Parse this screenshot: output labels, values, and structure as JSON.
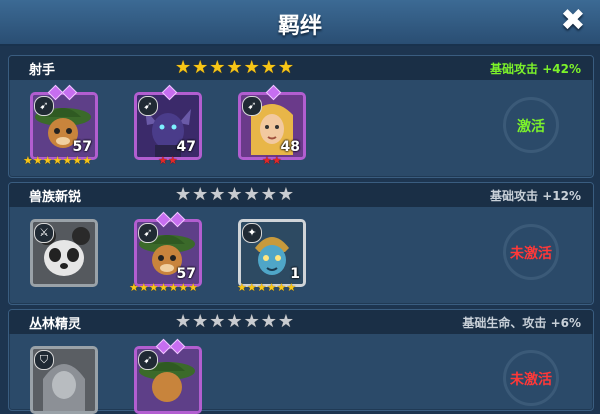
{
  "header": {
    "title": "羁绊",
    "close_icon": "close-icon"
  },
  "sections": [
    {
      "title": "射手",
      "stars": {
        "filled": 7,
        "total": 7
      },
      "bonus": "基础攻击 +42%",
      "bonus_color": "#7cf22a",
      "status": "激活",
      "heroes": [
        {
          "level": "57",
          "class_icon": "bow-icon",
          "stars": 7,
          "star_color": "gold",
          "gems": 2
        },
        {
          "level": "47",
          "class_icon": "bow-icon",
          "stars": 2,
          "star_color": "red",
          "gems": 1
        },
        {
          "level": "48",
          "class_icon": "bow-icon",
          "stars": 2,
          "star_color": "red",
          "gems": 1
        }
      ]
    },
    {
      "title": "兽族新锐",
      "stars": {
        "filled": 0,
        "total": 7
      },
      "bonus": "基础攻击 +12%",
      "bonus_color": "#c8d0d8",
      "status": "未激活",
      "heroes": [
        {
          "level": "",
          "class_icon": "sword-icon",
          "stars": 0,
          "star_color": "",
          "gems": 0
        },
        {
          "level": "57",
          "class_icon": "bow-icon",
          "stars": 7,
          "star_color": "gold",
          "gems": 2
        },
        {
          "level": "1",
          "class_icon": "magic-icon",
          "stars": 6,
          "star_color": "gold",
          "gems": 0
        }
      ]
    },
    {
      "title": "丛林精灵",
      "stars": {
        "filled": 0,
        "total": 7
      },
      "bonus": "基础生命、攻击 +6%",
      "bonus_color": "#c8d0d8",
      "status": "未激活",
      "heroes": [
        {
          "level": "",
          "class_icon": "shield-icon",
          "stars": 0,
          "star_color": "",
          "gems": 0
        },
        {
          "level": "",
          "class_icon": "bow-icon",
          "stars": 0,
          "star_color": "",
          "gems": 2
        }
      ]
    }
  ]
}
